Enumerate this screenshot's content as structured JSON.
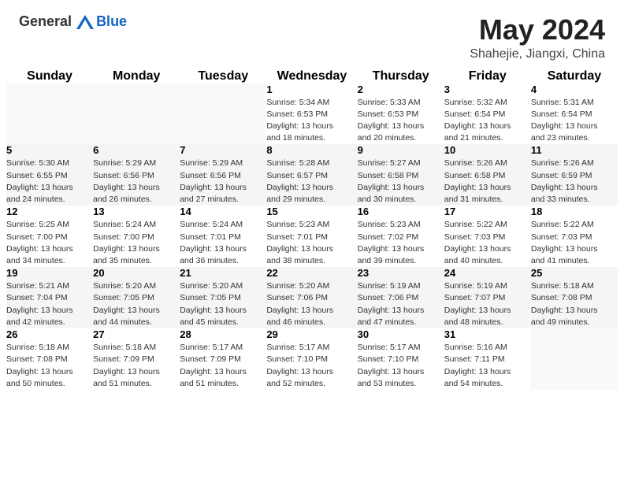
{
  "header": {
    "logo_line1": "General",
    "logo_line2": "Blue",
    "month": "May 2024",
    "location": "Shahejie, Jiangxi, China"
  },
  "days_of_week": [
    "Sunday",
    "Monday",
    "Tuesday",
    "Wednesday",
    "Thursday",
    "Friday",
    "Saturday"
  ],
  "weeks": [
    [
      {
        "day": "",
        "info": ""
      },
      {
        "day": "",
        "info": ""
      },
      {
        "day": "",
        "info": ""
      },
      {
        "day": "1",
        "info": "Sunrise: 5:34 AM\nSunset: 6:53 PM\nDaylight: 13 hours\nand 18 minutes."
      },
      {
        "day": "2",
        "info": "Sunrise: 5:33 AM\nSunset: 6:53 PM\nDaylight: 13 hours\nand 20 minutes."
      },
      {
        "day": "3",
        "info": "Sunrise: 5:32 AM\nSunset: 6:54 PM\nDaylight: 13 hours\nand 21 minutes."
      },
      {
        "day": "4",
        "info": "Sunrise: 5:31 AM\nSunset: 6:54 PM\nDaylight: 13 hours\nand 23 minutes."
      }
    ],
    [
      {
        "day": "5",
        "info": "Sunrise: 5:30 AM\nSunset: 6:55 PM\nDaylight: 13 hours\nand 24 minutes."
      },
      {
        "day": "6",
        "info": "Sunrise: 5:29 AM\nSunset: 6:56 PM\nDaylight: 13 hours\nand 26 minutes."
      },
      {
        "day": "7",
        "info": "Sunrise: 5:29 AM\nSunset: 6:56 PM\nDaylight: 13 hours\nand 27 minutes."
      },
      {
        "day": "8",
        "info": "Sunrise: 5:28 AM\nSunset: 6:57 PM\nDaylight: 13 hours\nand 29 minutes."
      },
      {
        "day": "9",
        "info": "Sunrise: 5:27 AM\nSunset: 6:58 PM\nDaylight: 13 hours\nand 30 minutes."
      },
      {
        "day": "10",
        "info": "Sunrise: 5:26 AM\nSunset: 6:58 PM\nDaylight: 13 hours\nand 31 minutes."
      },
      {
        "day": "11",
        "info": "Sunrise: 5:26 AM\nSunset: 6:59 PM\nDaylight: 13 hours\nand 33 minutes."
      }
    ],
    [
      {
        "day": "12",
        "info": "Sunrise: 5:25 AM\nSunset: 7:00 PM\nDaylight: 13 hours\nand 34 minutes."
      },
      {
        "day": "13",
        "info": "Sunrise: 5:24 AM\nSunset: 7:00 PM\nDaylight: 13 hours\nand 35 minutes."
      },
      {
        "day": "14",
        "info": "Sunrise: 5:24 AM\nSunset: 7:01 PM\nDaylight: 13 hours\nand 36 minutes."
      },
      {
        "day": "15",
        "info": "Sunrise: 5:23 AM\nSunset: 7:01 PM\nDaylight: 13 hours\nand 38 minutes."
      },
      {
        "day": "16",
        "info": "Sunrise: 5:23 AM\nSunset: 7:02 PM\nDaylight: 13 hours\nand 39 minutes."
      },
      {
        "day": "17",
        "info": "Sunrise: 5:22 AM\nSunset: 7:03 PM\nDaylight: 13 hours\nand 40 minutes."
      },
      {
        "day": "18",
        "info": "Sunrise: 5:22 AM\nSunset: 7:03 PM\nDaylight: 13 hours\nand 41 minutes."
      }
    ],
    [
      {
        "day": "19",
        "info": "Sunrise: 5:21 AM\nSunset: 7:04 PM\nDaylight: 13 hours\nand 42 minutes."
      },
      {
        "day": "20",
        "info": "Sunrise: 5:20 AM\nSunset: 7:05 PM\nDaylight: 13 hours\nand 44 minutes."
      },
      {
        "day": "21",
        "info": "Sunrise: 5:20 AM\nSunset: 7:05 PM\nDaylight: 13 hours\nand 45 minutes."
      },
      {
        "day": "22",
        "info": "Sunrise: 5:20 AM\nSunset: 7:06 PM\nDaylight: 13 hours\nand 46 minutes."
      },
      {
        "day": "23",
        "info": "Sunrise: 5:19 AM\nSunset: 7:06 PM\nDaylight: 13 hours\nand 47 minutes."
      },
      {
        "day": "24",
        "info": "Sunrise: 5:19 AM\nSunset: 7:07 PM\nDaylight: 13 hours\nand 48 minutes."
      },
      {
        "day": "25",
        "info": "Sunrise: 5:18 AM\nSunset: 7:08 PM\nDaylight: 13 hours\nand 49 minutes."
      }
    ],
    [
      {
        "day": "26",
        "info": "Sunrise: 5:18 AM\nSunset: 7:08 PM\nDaylight: 13 hours\nand 50 minutes."
      },
      {
        "day": "27",
        "info": "Sunrise: 5:18 AM\nSunset: 7:09 PM\nDaylight: 13 hours\nand 51 minutes."
      },
      {
        "day": "28",
        "info": "Sunrise: 5:17 AM\nSunset: 7:09 PM\nDaylight: 13 hours\nand 51 minutes."
      },
      {
        "day": "29",
        "info": "Sunrise: 5:17 AM\nSunset: 7:10 PM\nDaylight: 13 hours\nand 52 minutes."
      },
      {
        "day": "30",
        "info": "Sunrise: 5:17 AM\nSunset: 7:10 PM\nDaylight: 13 hours\nand 53 minutes."
      },
      {
        "day": "31",
        "info": "Sunrise: 5:16 AM\nSunset: 7:11 PM\nDaylight: 13 hours\nand 54 minutes."
      },
      {
        "day": "",
        "info": ""
      }
    ]
  ]
}
